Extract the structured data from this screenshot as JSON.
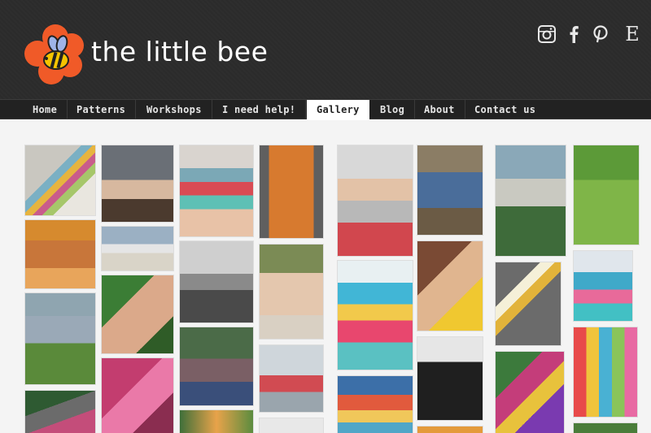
{
  "site": {
    "name": "the little bee"
  },
  "social": [
    {
      "icon": "instagram-icon",
      "label": "Instagram"
    },
    {
      "icon": "facebook-icon",
      "label": "Facebook"
    },
    {
      "icon": "pinterest-icon",
      "label": "Pinterest"
    },
    {
      "icon": "etsy-icon",
      "label": "Etsy"
    }
  ],
  "nav": [
    {
      "label": "Home",
      "active": false
    },
    {
      "label": "Patterns",
      "active": false
    },
    {
      "label": "Workshops",
      "active": false
    },
    {
      "label": "I need help!",
      "active": false
    },
    {
      "label": "Gallery",
      "active": true
    },
    {
      "label": "Blog",
      "active": false
    },
    {
      "label": "About",
      "active": false
    },
    {
      "label": "Contact us",
      "active": false
    }
  ],
  "colors": {
    "header": "#2b2b2b",
    "nav": "#222222",
    "logo_flower": "#f05a28",
    "bee": "#f5c400"
  }
}
